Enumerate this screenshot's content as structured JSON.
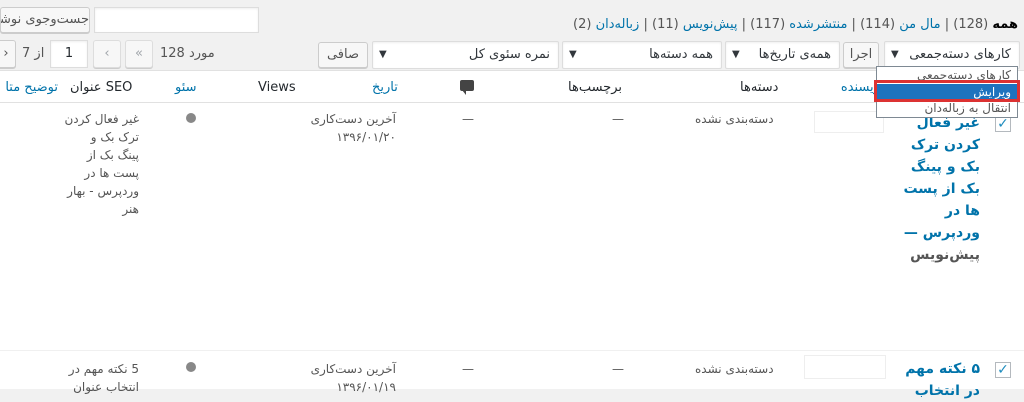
{
  "search": {
    "button_label": "جست‌وجوی نوشته"
  },
  "status_links": {
    "all": "همه",
    "all_count": "(128)",
    "sep": "|",
    "mine": "مال من",
    "mine_count": "(114)",
    "published": "منتشرشده",
    "published_count": "(117)",
    "draft": "پیش‌نویس",
    "draft_count": "(11)",
    "trash": "زباله‌دان",
    "trash_count": "(2)"
  },
  "filters": {
    "bulk_actions": "کارهای دسته‌جمعی",
    "apply": "اجرا",
    "dates": "همه‌ی تاریخ‌ها",
    "categories": "همه دسته‌ها",
    "seo_score": "نمره سئوی کل",
    "filter_button": "صافی"
  },
  "bulk_menu": {
    "items": [
      "کارهای دسته‌جمعی",
      "ویرایش",
      "انتقال به زباله‌دان"
    ],
    "selected": "ویرایش"
  },
  "pagination": {
    "items_count": "128 مورد",
    "first": "«",
    "prev": "‹",
    "current_page": "1",
    "of_label": "از 7",
    "next": "›"
  },
  "columns": {
    "author": "نویسنده",
    "categories": "دسته‌ها",
    "tags": "برچسب‌ها",
    "comments_icon": "comment-bubble-icon",
    "date": "تاریخ",
    "views": "Views",
    "seo": "سئو",
    "seo_title": "عنوان SEO",
    "meta_desc": "توضیح متا"
  },
  "rows": [
    {
      "title_lines": [
        "غیر فعال",
        "کردن ترک",
        "بک و پینگ",
        "بک از پست",
        "ها در",
        "وردپرس —"
      ],
      "state": "پیش‌نویس",
      "category": "دسته‌بندی نشده",
      "tags": "—",
      "comments": "—",
      "date_label": "آخرین دست‌کاری",
      "date_value": "۱۳۹۶/۰۱/۲۰",
      "seo_title_lines": [
        "غیر فعال کردن",
        "ترک بک و",
        "پینگ بک از",
        "پست ها در",
        "وردپرس - بهار",
        "هنر"
      ]
    },
    {
      "title_lines": [
        "۵ نکته مهم",
        "در انتخاب"
      ],
      "category": "دسته‌بندی نشده",
      "tags": "—",
      "comments": "—",
      "date_label": "آخرین دست‌کاری",
      "date_value": "۱۳۹۶/۰۱/۱۹",
      "seo_title_lines": [
        "5 نکته مهم در",
        "انتخاب عنوان"
      ]
    }
  ],
  "colors": {
    "link": "#0073aa",
    "highlight_border": "#dc3232",
    "menu_selected": "#1e73be"
  }
}
